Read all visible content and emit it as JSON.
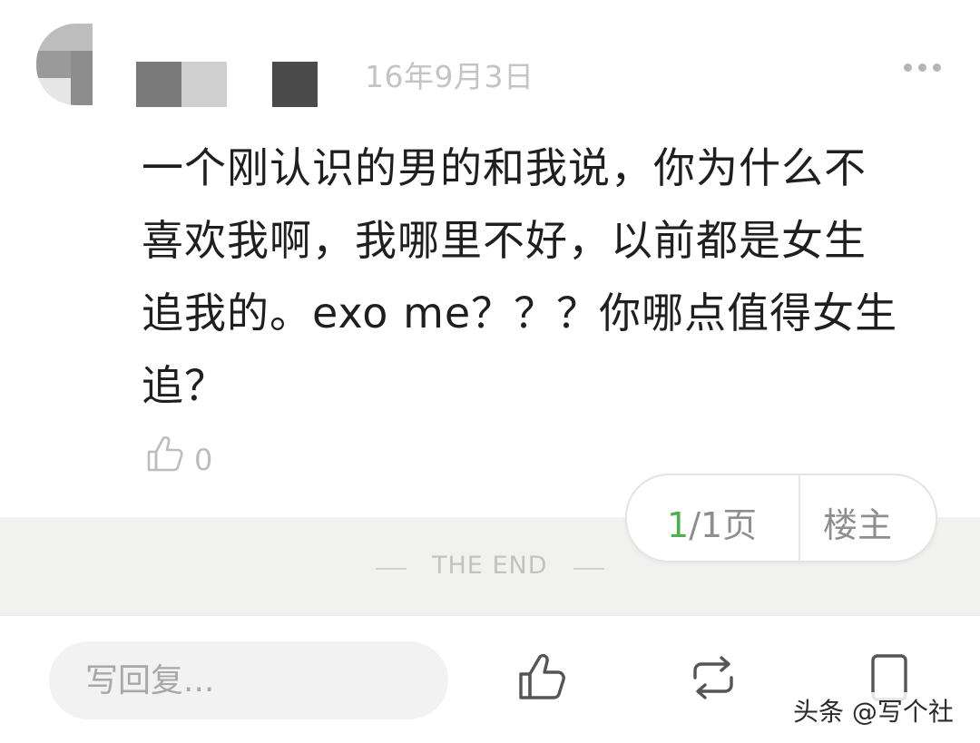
{
  "comment": {
    "date": "16年9月3日",
    "text": "一个刚认识的男的和我说，你为什么不\n喜欢我啊，我哪里不好，以前都是女生\n追我的。exo me？？？你哪点值得女生\n追？",
    "like_count": "0",
    "icons": {
      "more": "more-horizontal-icon",
      "like": "thumbs-up-icon"
    }
  },
  "end_strip": {
    "text": "THE END"
  },
  "pager": {
    "current_page": "1",
    "page_rest": "/1页",
    "owner_label": "楼主",
    "accent_color": "#4caf50"
  },
  "bottom_bar": {
    "reply_placeholder": "写回复...",
    "icons": {
      "like": "thumbs-up-icon",
      "share": "repost-icon",
      "favorite": "bookmark-icon"
    }
  },
  "watermark": {
    "text": "头条 @写个社"
  }
}
